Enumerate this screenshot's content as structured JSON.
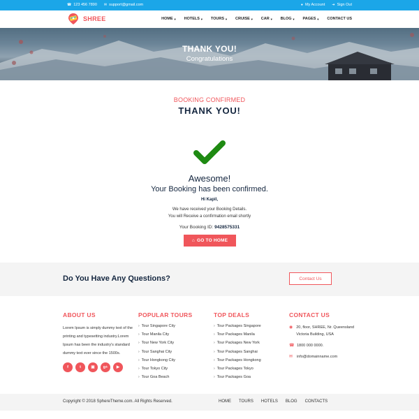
{
  "topbar": {
    "phone": "123 456 7890",
    "email": "support@gmail.com",
    "account": "My Account",
    "signout": "Sign Out"
  },
  "brand": {
    "name": "SHREE",
    "color": "#f0565b"
  },
  "nav": [
    {
      "label": "HOME",
      "caret": true
    },
    {
      "label": "HOTELS",
      "caret": true
    },
    {
      "label": "TOURS",
      "caret": true
    },
    {
      "label": "CRUISE",
      "caret": true
    },
    {
      "label": "CAR",
      "caret": true
    },
    {
      "label": "BLOG",
      "caret": true
    },
    {
      "label": "PAGES",
      "caret": true
    },
    {
      "label": "CONTACT US",
      "caret": false
    }
  ],
  "hero": {
    "title": "THANK YOU!",
    "subtitle": "Congratulations"
  },
  "confirmation": {
    "eyebrow": "BOOKING CONFIRMED",
    "title": "THANK YOU!",
    "heading": "Awesome!",
    "subheading": "Your Booking has been confirmed.",
    "greeting": "Hi Kapil,",
    "message_line1": "We have received your Booking Details.",
    "message_line2": "You will Receive a confirmation email shortly",
    "booking_id_label": "Your Booking ID:",
    "booking_id": "9428575331",
    "button_label": "GO TO HOME",
    "check_color": "#1e8a12"
  },
  "questions": {
    "text": "Do You Have Any Questions?",
    "button_label": "Contact Us"
  },
  "footer": {
    "about": {
      "heading": "ABOUT US",
      "text": "Lorem Ipsum is simply dummy text of the printing and typesetting industry.Lorem Ipsum has been the industry's standard dummy text ever since the 1500s.",
      "socials": [
        "facebook-icon",
        "twitter-icon",
        "instagram-icon",
        "google-plus-icon",
        "youtube-icon"
      ]
    },
    "popular_tours": {
      "heading": "POPULAR TOURS",
      "items": [
        "Tour Singapore City",
        "Tour Manila City",
        "Tour New York City",
        "Tour Sanghai City",
        "Tour Hongkong City",
        "Tour Tokyo City",
        "Tour Goa Beach"
      ]
    },
    "top_deals": {
      "heading": "TOP DEALS",
      "items": [
        "Tour Packages Singapore",
        "Tour Packages Manila",
        "Tour Packages New York",
        "Tour Packages Sanghai",
        "Tour Packages Hongkong",
        "Tour Packages Tokyo",
        "Tour Packages Goa"
      ]
    },
    "contact": {
      "heading": "CONTACT US",
      "address": "20, floor, SHREE, Nr. Queensland Victoria Building, USA",
      "phone": "1800 000 0000.",
      "email": "info@domainname.com"
    }
  },
  "bottom": {
    "copyright": "Copyright © 2018 SphereTheme.com. All Rights Reserved.",
    "links": [
      "HOME",
      "TOURS",
      "HOTELS",
      "BLOG",
      "CONTACTS"
    ]
  }
}
